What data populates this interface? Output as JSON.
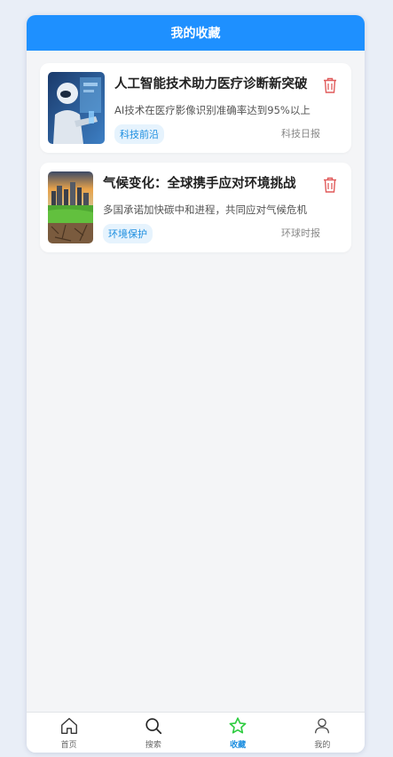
{
  "header": {
    "title": "我的收藏"
  },
  "favorites": [
    {
      "title": "人工智能技术助力医疗诊断新突破",
      "summary": "AI技术在医疗影像识别准确率达到95%以上",
      "tag": "科技前沿",
      "source": "科技日报",
      "thumbnail_icon": "robot-doctor-image"
    },
    {
      "title": "气候变化：全球携手应对环境挑战",
      "summary": "多国承诺加快碳中和进程，共同应对气候危机",
      "tag": "环境保护",
      "source": "环球时报",
      "thumbnail_icon": "climate-city-image"
    }
  ],
  "tabbar": {
    "items": [
      {
        "label": "首页",
        "icon": "home-icon",
        "active": false
      },
      {
        "label": "搜索",
        "icon": "search-icon",
        "active": false
      },
      {
        "label": "收藏",
        "icon": "star-icon",
        "active": true
      },
      {
        "label": "我的",
        "icon": "user-icon",
        "active": false
      }
    ]
  },
  "colors": {
    "primary": "#1e90ff",
    "active_star": "#2ecc40",
    "delete": "#e05a5a",
    "tag_text": "#1e8fe0",
    "tag_bg": "#e6f3fd"
  }
}
